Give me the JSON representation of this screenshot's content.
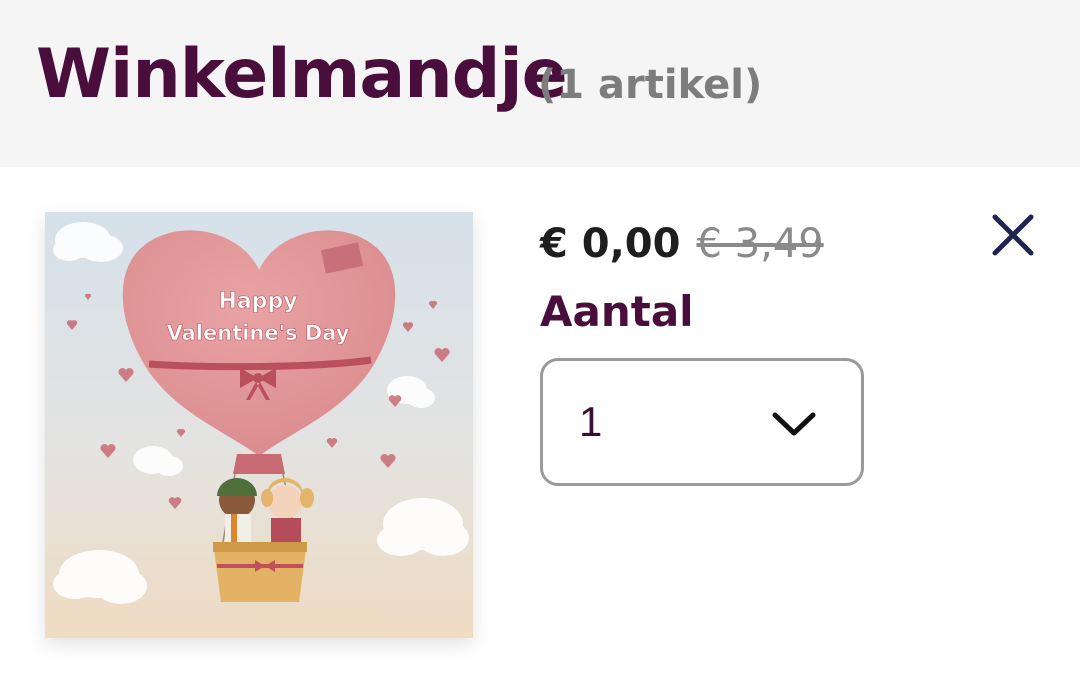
{
  "header": {
    "title": "Winkelmandje",
    "item_count": "(1 artikel)"
  },
  "product": {
    "image_text_line1": "Happy",
    "image_text_line2": "Valentine's Day",
    "price_current": "€ 0,00",
    "price_old": "€ 3,49",
    "quantity_label": "Aantal",
    "quantity_value": "1",
    "remove_icon": "close-icon",
    "dropdown_icon": "chevron-down-icon"
  },
  "colors": {
    "title": "#4a0e3c",
    "header_bg": "#f5f5f5",
    "price": "#1e1e1e",
    "price_old": "#8a8a8a",
    "close_icon": "#1f2450"
  }
}
